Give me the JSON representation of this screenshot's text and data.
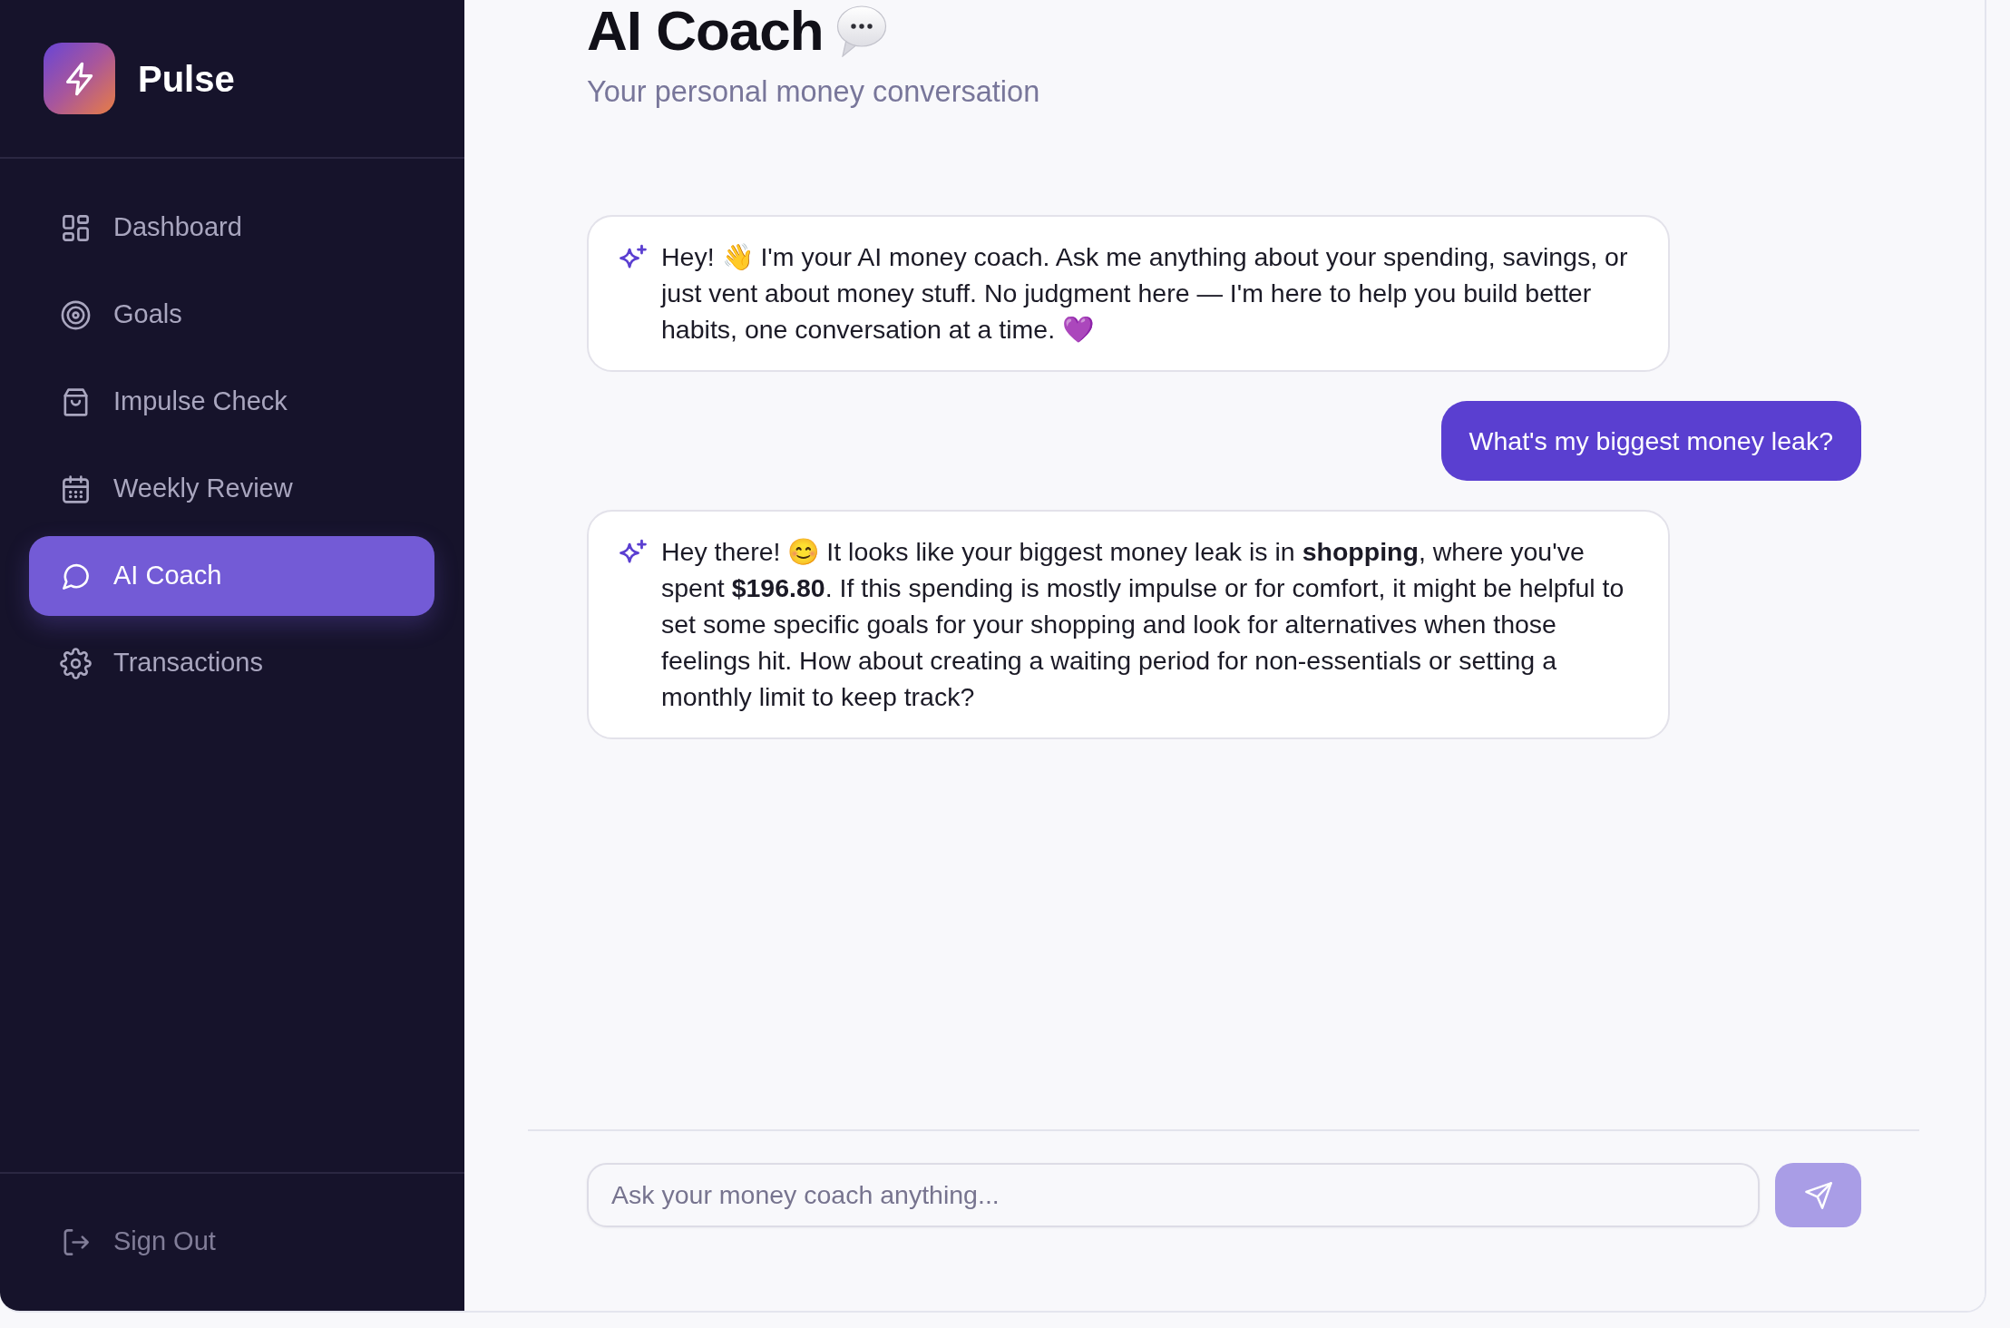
{
  "sidebar": {
    "brand": "Pulse",
    "items": [
      {
        "label": "Dashboard",
        "selected": false
      },
      {
        "label": "Goals",
        "selected": false
      },
      {
        "label": "Impulse Check",
        "selected": false
      },
      {
        "label": "Weekly Review",
        "selected": false
      },
      {
        "label": "AI Coach",
        "selected": true
      },
      {
        "label": "Transactions",
        "selected": false
      }
    ],
    "footer_item": {
      "label": "Sign Out"
    }
  },
  "header": {
    "title": "AI Coach",
    "subtitle": "Your personal money conversation"
  },
  "messages": [
    {
      "kind": "coach",
      "text": "Hey! 👋 I'm your AI money coach. Ask me anything about your spending, savings, or just vent about money stuff. No judgment here — I'm here to help you build better habits, one conversation at a time. 💜"
    },
    {
      "kind": "user",
      "text": "What's my biggest money leak?"
    },
    {
      "kind": "coach",
      "text": "Hey there! 😊 It looks like your biggest money leak is in **shopping**, where you've spent **$196.80**. If this spending is mostly impulse or for comfort, it might be helpful to set some specific goals for your shopping and look for alternatives when those feelings hit. How about creating a waiting period for non-essentials or setting a monthly limit to keep track?"
    }
  ],
  "composer": {
    "placeholder": "Ask your money coach anything...",
    "send_button": {
      "disabled": true
    }
  }
}
